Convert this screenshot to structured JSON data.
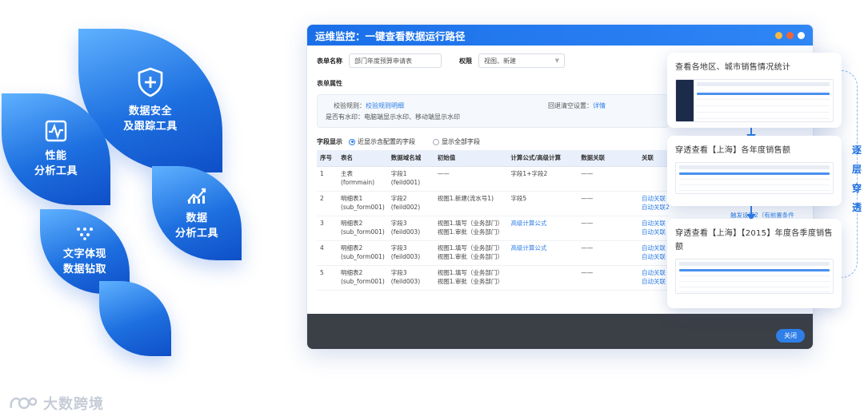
{
  "tiles": {
    "performance": {
      "line1": "性能",
      "line2": "分析工具",
      "icon": "pulse-chart-icon"
    },
    "security": {
      "line1": "数据安全",
      "line2": "及跟踪工具",
      "icon": "shield-plus-icon"
    },
    "data": {
      "line1": "数据",
      "line2": "分析工具",
      "icon": "bar-chart-icon"
    },
    "text": {
      "line1": "文字体现",
      "line2": "数据钻取",
      "icon": "dot-grid-icon"
    }
  },
  "brand": {
    "logo_text": "大数跨境"
  },
  "window": {
    "title": "运维监控：一键查看数据运行路径",
    "form_name_label": "表单名称",
    "form_name_value": "部门年度预算申请表",
    "permission_label": "权限",
    "permission_value": "视图、新建",
    "attr_title": "表单属性",
    "validation_label": "校验规则：",
    "validation_value": "校验规则明细",
    "writeback_label": "回退清空设置：",
    "writeback_value": "详情",
    "watermark_label": "是否有水印：",
    "watermark_value": "电脑端显示水印、移动端显示水印",
    "field_display_label": "字段显示",
    "radio_configured": "近显示含配置的字段",
    "radio_all": "显示全部字段",
    "close_label": "关闭",
    "columns": [
      "序号",
      "表名",
      "数据域名城",
      "初始值",
      "计算公式/高级计算",
      "数据关联",
      "关联"
    ],
    "rows": [
      {
        "no": "1",
        "table": "主表",
        "table2": "(formmain)",
        "field": "字段1",
        "field2": "(feild001)",
        "init": "——",
        "init2": "",
        "calc": "字段1+字段2",
        "calc_link": false,
        "rel": "——",
        "link1": "",
        "link2": ""
      },
      {
        "no": "2",
        "table": "明细表1",
        "table2": "(sub_form001)",
        "field": "字段2",
        "field2": "(feild002)",
        "init": "视图1.新建(流水号1)",
        "init2": "",
        "calc": "字段5",
        "calc_link": false,
        "rel": "——",
        "link1": "自动关联",
        "link2": "自动关联2（无前置条件"
      },
      {
        "no": "3",
        "table": "明细表2",
        "table2": "(sub_form001)",
        "field": "字段3",
        "field2": "(feild003)",
        "init": "视图1.填写（业务部门）",
        "init2": "视图1.审批（业务部门）",
        "calc": "高级计算公式",
        "calc_link": true,
        "rel": "——",
        "link1": "自动关联",
        "link2": "自动关联"
      },
      {
        "no": "4",
        "table": "明细表2",
        "table2": "(sub_form001)",
        "field": "字段3",
        "field2": "(feild003)",
        "init": "视图1.填写（业务部门）",
        "init2": "视图1.审批（业务部门）",
        "calc": "高级计算公式",
        "calc_link": true,
        "rel": "——",
        "link1": "自动关联",
        "link2": "自动关联"
      },
      {
        "no": "5",
        "table": "明细表2",
        "table2": "(sub_form001)",
        "field": "字段3",
        "field2": "(feild003)",
        "init": "视图1.填写（业务部门）",
        "init2": "视图1.审批（业务部门）",
        "calc": "",
        "calc_link": false,
        "rel": "——",
        "link1": "自动关联",
        "link2": "自动关联"
      }
    ],
    "overlap_text": "触发设置2（有前置条件"
  },
  "cards": [
    {
      "title": "查看各地区、城市销售情况统计"
    },
    {
      "title": "穿透查看【上海】各年度销售额"
    },
    {
      "title": "穿透查看【上海】【2015】年度各季度销售额"
    }
  ],
  "side_label": {
    "chars": [
      "逐",
      "层",
      "穿",
      "透"
    ]
  },
  "colors": {
    "accent": "#2f7fe8",
    "title_bar": "#1a6fe8",
    "dot_yellow": "#f5b942",
    "dot_red": "#f0643c",
    "dot_white": "#ffffff",
    "footer": "#3b3f46"
  }
}
